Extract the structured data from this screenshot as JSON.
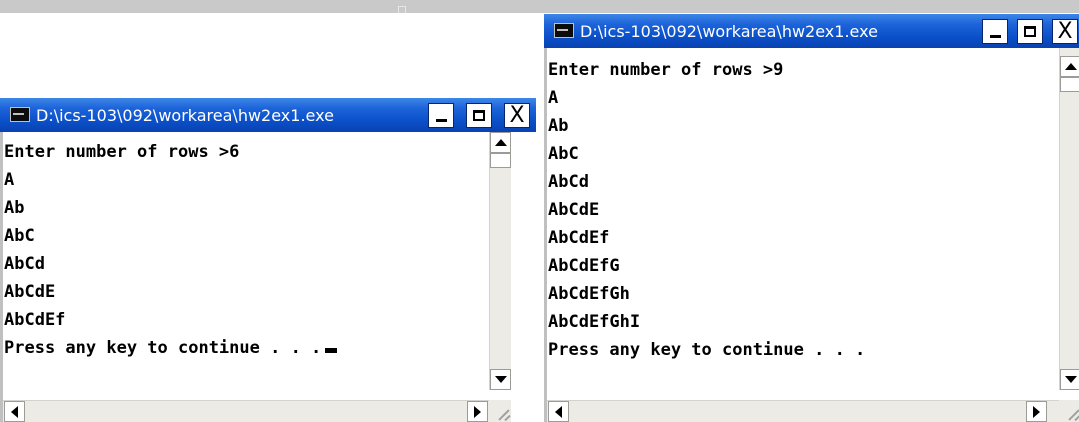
{
  "windows": [
    {
      "title": "D:\\ics-103\\092\\workarea\\hw2ex1.exe",
      "lines": [
        "Enter number of rows >6",
        "A",
        "Ab",
        "AbC",
        "AbCd",
        "AbCdE",
        "AbCdEf",
        "Press any key to continue . . ."
      ],
      "cursor_visible": true
    },
    {
      "title": "D:\\ics-103\\092\\workarea\\hw2ex1.exe",
      "lines": [
        "Enter number of rows >9",
        "A",
        "Ab",
        "AbC",
        "AbCd",
        "AbCdE",
        "AbCdEf",
        "AbCdEfG",
        "AbCdEfGh",
        "AbCdEfGhI",
        "Press any key to continue . . ."
      ],
      "cursor_visible": false
    }
  ],
  "icons": {
    "app": "console-app-icon",
    "minimize": "minimize-icon",
    "maximize": "maximize-icon",
    "close": "close-icon",
    "close_glyph": "X"
  },
  "colors": {
    "titlebar": "#0a4fc8",
    "title_text": "#ffffff",
    "console_bg": "#ffffff",
    "console_text": "#000000",
    "scrollbar_track": "#ecebe6"
  }
}
